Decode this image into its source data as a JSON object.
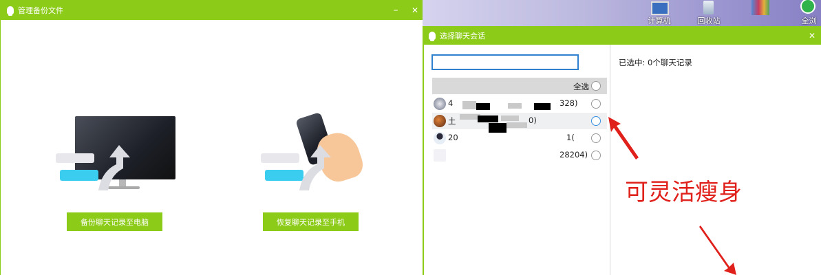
{
  "backup_window": {
    "title": "管理备份文件",
    "minimize_label": "–",
    "close_label": "✕",
    "backup_button": "备份聊天记录至电脑",
    "restore_button": "恢复聊天记录至手机"
  },
  "desktop": {
    "icons": [
      {
        "label": "计算机",
        "icon": "computer-icon"
      },
      {
        "label": "回收站",
        "icon": "recycle-bin-icon"
      },
      {
        "label": "",
        "icon": "archive-icon"
      },
      {
        "label": "全浏",
        "icon": "browser-icon"
      }
    ]
  },
  "select_window": {
    "title": "选择聊天会话",
    "close_label": "✕",
    "search_value": "",
    "select_all_label": "全选",
    "selected_status": "已选中: 0个聊天记录",
    "sessions": [
      {
        "name": "4",
        "suffix": "328)",
        "avatar": "group-avatar"
      },
      {
        "name": "土",
        "suffix": "0)",
        "avatar": "guitar-avatar"
      },
      {
        "name": "20",
        "suffix": "1(",
        "avatar": "girl-avatar"
      },
      {
        "name": "",
        "suffix": "28204)",
        "avatar": "figure-avatar"
      }
    ]
  },
  "annotation": {
    "text": "可灵活瘦身",
    "color": "#e0201a"
  },
  "colors": {
    "accent": "#8ccb17",
    "desktop_bg": "#b8b4dd"
  }
}
